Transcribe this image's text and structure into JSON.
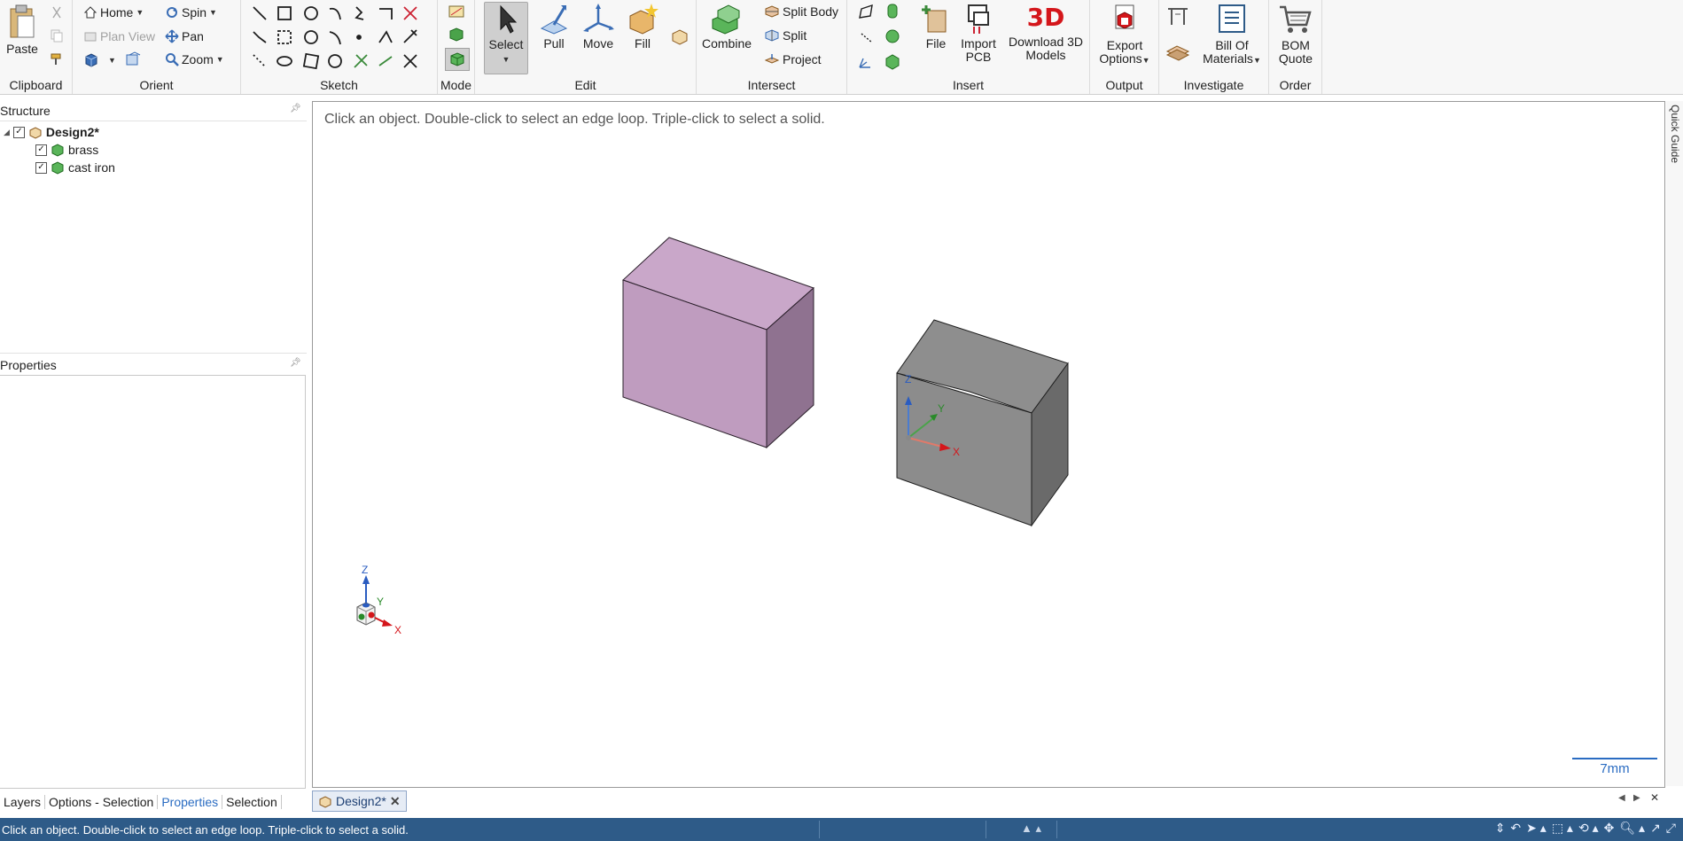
{
  "ribbon": {
    "clipboard": {
      "label": "Clipboard",
      "paste": "Paste"
    },
    "orient": {
      "label": "Orient",
      "home": "Home",
      "spin": "Spin",
      "plan_view": "Plan View",
      "pan": "Pan",
      "zoom": "Zoom"
    },
    "sketch": {
      "label": "Sketch"
    },
    "mode": {
      "label": "Mode"
    },
    "edit": {
      "label": "Edit",
      "select": "Select",
      "pull": "Pull",
      "move": "Move",
      "fill": "Fill"
    },
    "intersect": {
      "label": "Intersect",
      "combine": "Combine",
      "split_body": "Split Body",
      "split": "Split",
      "project": "Project"
    },
    "insert": {
      "label": "Insert",
      "file": "File",
      "import_pcb_1": "Import",
      "import_pcb_2": "PCB",
      "download_1": "Download 3D",
      "download_2": "Models",
      "download_badge": "3D"
    },
    "output": {
      "label": "Output",
      "export_1": "Export",
      "export_2": "Options"
    },
    "investigate": {
      "label": "Investigate",
      "bom_1": "Bill Of",
      "bom_2": "Materials"
    },
    "order": {
      "label": "Order",
      "quote_1": "BOM",
      "quote_2": "Quote"
    }
  },
  "structure": {
    "title": "Structure",
    "root": "Design2*",
    "items": [
      {
        "label": "brass"
      },
      {
        "label": "cast iron"
      }
    ]
  },
  "properties": {
    "title": "Properties"
  },
  "viewport": {
    "hint": "Click an object. Double-click to select an edge loop. Triple-click to select a solid.",
    "scale_label": "7mm",
    "axes": {
      "x": "X",
      "y": "Y",
      "z": "Z"
    },
    "colors": {
      "brass_front": "#bf9cbf",
      "brass_top": "#c9a7c9",
      "brass_side": "#8f7290",
      "iron_front": "#8c8c8c",
      "iron_top": "#8e8e8e",
      "iron_side": "#6a6a6a"
    }
  },
  "quick_guide": "Quick Guide",
  "bottom_tabs": [
    {
      "label": "Layers"
    },
    {
      "label": "Options - Selection"
    },
    {
      "label": "Properties"
    },
    {
      "label": "Selection"
    }
  ],
  "doc_tab": {
    "label": "Design2*"
  },
  "status": {
    "message": "Click an object. Double-click to select an edge loop. Triple-click to select a solid."
  }
}
